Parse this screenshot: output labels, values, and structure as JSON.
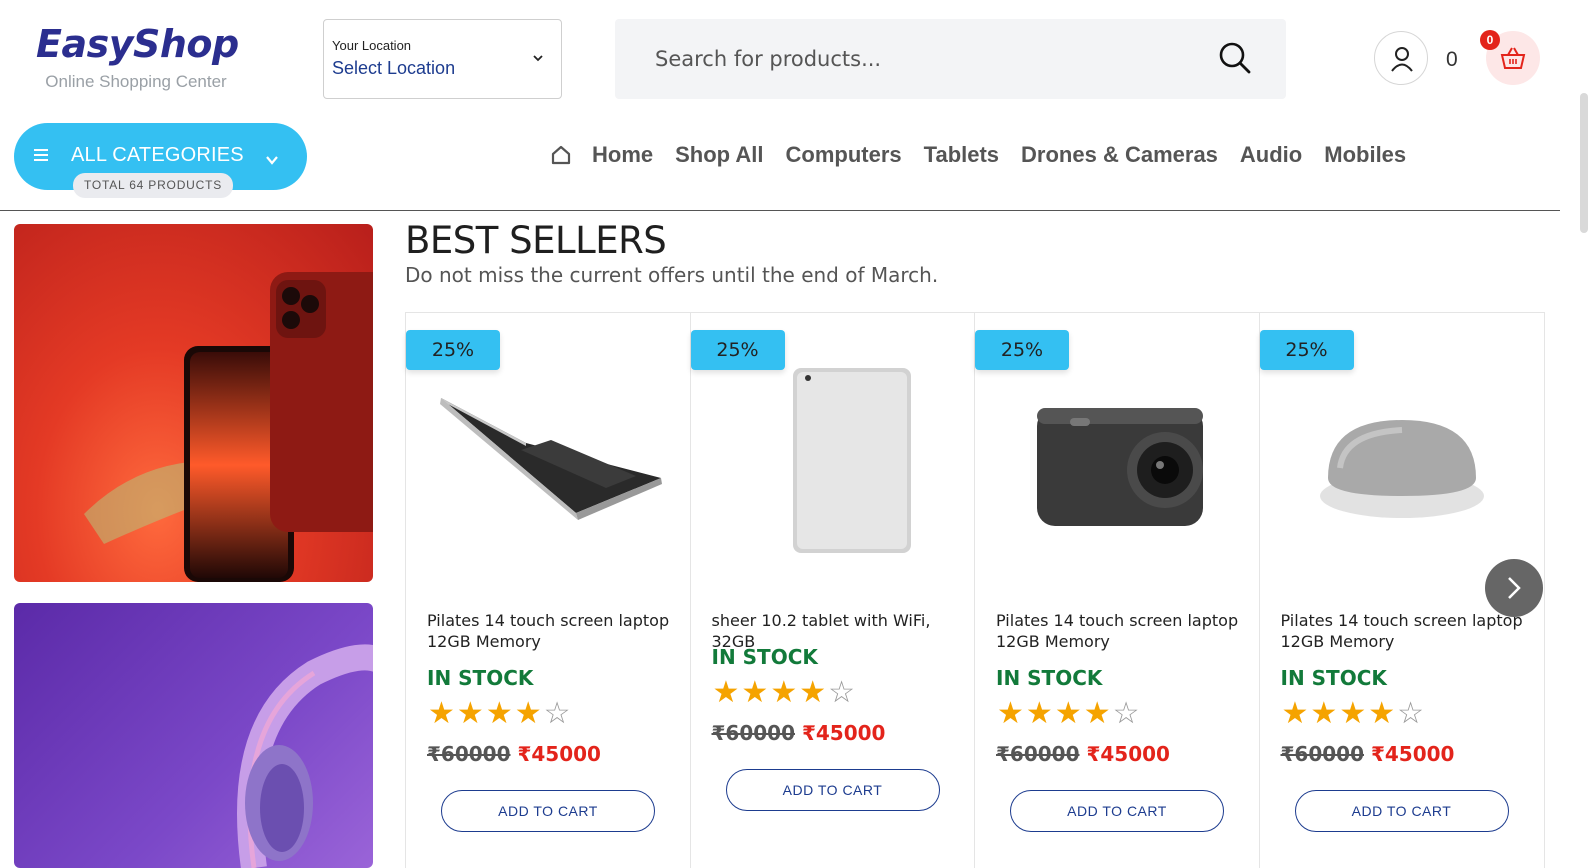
{
  "header": {
    "logo_title": "EasyShop",
    "logo_subtitle": "Online Shopping Center",
    "location_label": "Your Location",
    "location_value": "Select Location",
    "search_placeholder": "Search for products...",
    "user_count": "0",
    "cart_count": "0"
  },
  "nav": {
    "categories_label": "ALL CATEGORIES",
    "total_products": "TOTAL 64 PRODUCTS",
    "links": [
      "Home",
      "Shop All",
      "Computers",
      "Tablets",
      "Drones & Cameras",
      "Audio",
      "Mobiles"
    ]
  },
  "section": {
    "title": "BEST SELLERS",
    "subtitle": "Do not miss the current offers until the end of March."
  },
  "products": [
    {
      "discount": "25%",
      "name": "Pilates 14 touch screen laptop 12GB Memory",
      "stock": "IN STOCK",
      "rating": 4,
      "old_price": "₹60000",
      "new_price": "₹45000",
      "button": "ADD TO CART",
      "icon": "laptop-image"
    },
    {
      "discount": "25%",
      "name": "sheer 10.2 tablet with WiFi, 32GB",
      "stock": "IN STOCK",
      "rating": 4,
      "old_price": "₹60000",
      "new_price": "₹45000",
      "button": "ADD TO CART",
      "icon": "tablet-image"
    },
    {
      "discount": "25%",
      "name": "Pilates 14 touch screen laptop 12GB Memory",
      "stock": "IN STOCK",
      "rating": 4,
      "old_price": "₹60000",
      "new_price": "₹45000",
      "button": "ADD TO CART",
      "icon": "camera-image"
    },
    {
      "discount": "25%",
      "name": "Pilates 14 touch screen laptop 12GB Memory",
      "stock": "IN STOCK",
      "rating": 4,
      "old_price": "₹60000",
      "new_price": "₹45000",
      "button": "ADD TO CART",
      "icon": "smart-speaker-image"
    }
  ],
  "colors": {
    "accent": "#34c0f2",
    "brand": "#2b2e8f",
    "stock": "#127a3a",
    "price": "#e3241b",
    "star": "#f5a300"
  }
}
